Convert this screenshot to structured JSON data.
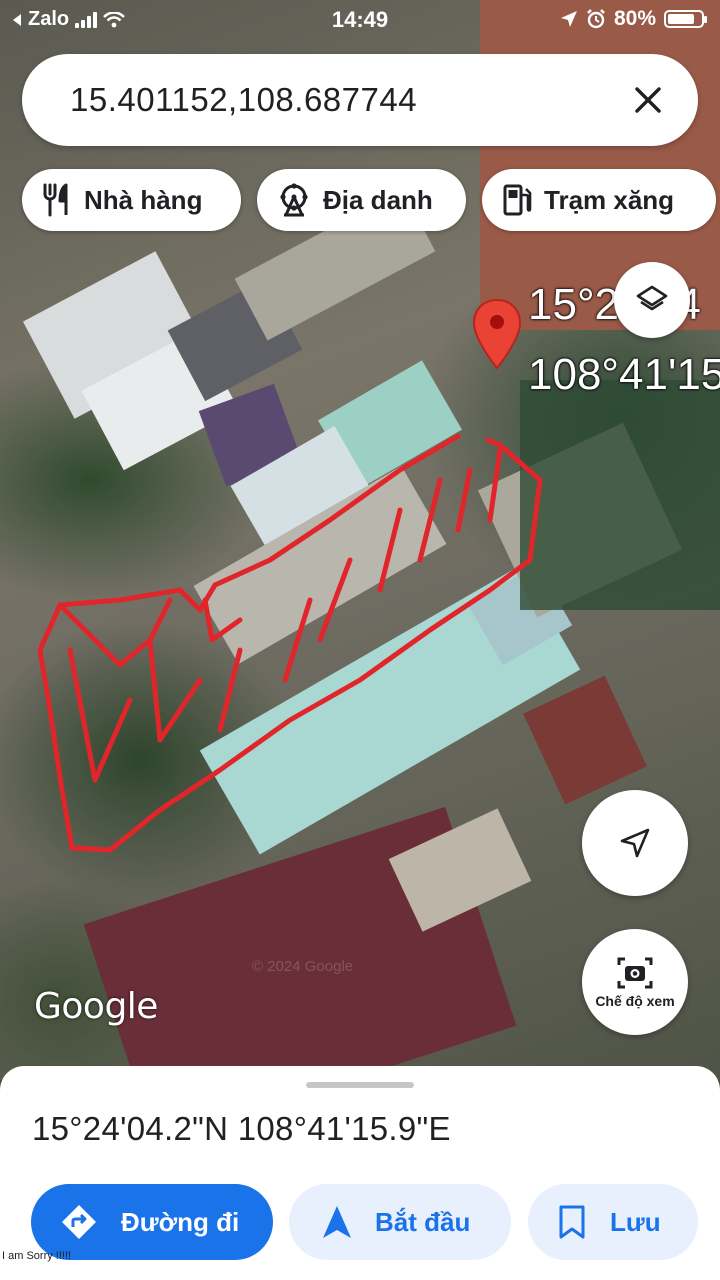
{
  "status_bar": {
    "back_app": "Zalo",
    "time": "14:49",
    "battery": "80%",
    "battery_level": 0.8
  },
  "search": {
    "query": "15.401152,108.687744"
  },
  "chips": [
    {
      "label": "Nhà hàng",
      "icon": "fork-knife-icon"
    },
    {
      "label": "Địa danh",
      "icon": "ferris-wheel-icon"
    },
    {
      "label": "Trạm xăng",
      "icon": "gas-pump-icon"
    }
  ],
  "map": {
    "pin_label_lat": "15°24'04",
    "pin_label_lon": "108°41'15",
    "attribution": "Google",
    "watermark": "© 2024 Google",
    "highlight_color": "#e0262b"
  },
  "view_mode": {
    "label": "Chế độ xem"
  },
  "place": {
    "coordinates": "15°24'04.2\"N 108°41'15.9\"E"
  },
  "actions": {
    "directions": "Đường đi",
    "start": "Bắt đầu",
    "save": "Lưu"
  },
  "footer_note": "I am Sorry !!!!!",
  "colors": {
    "accent_blue": "#1a73e8",
    "light_blue_bg": "#e8f0fe",
    "pin_red": "#ea4335"
  }
}
